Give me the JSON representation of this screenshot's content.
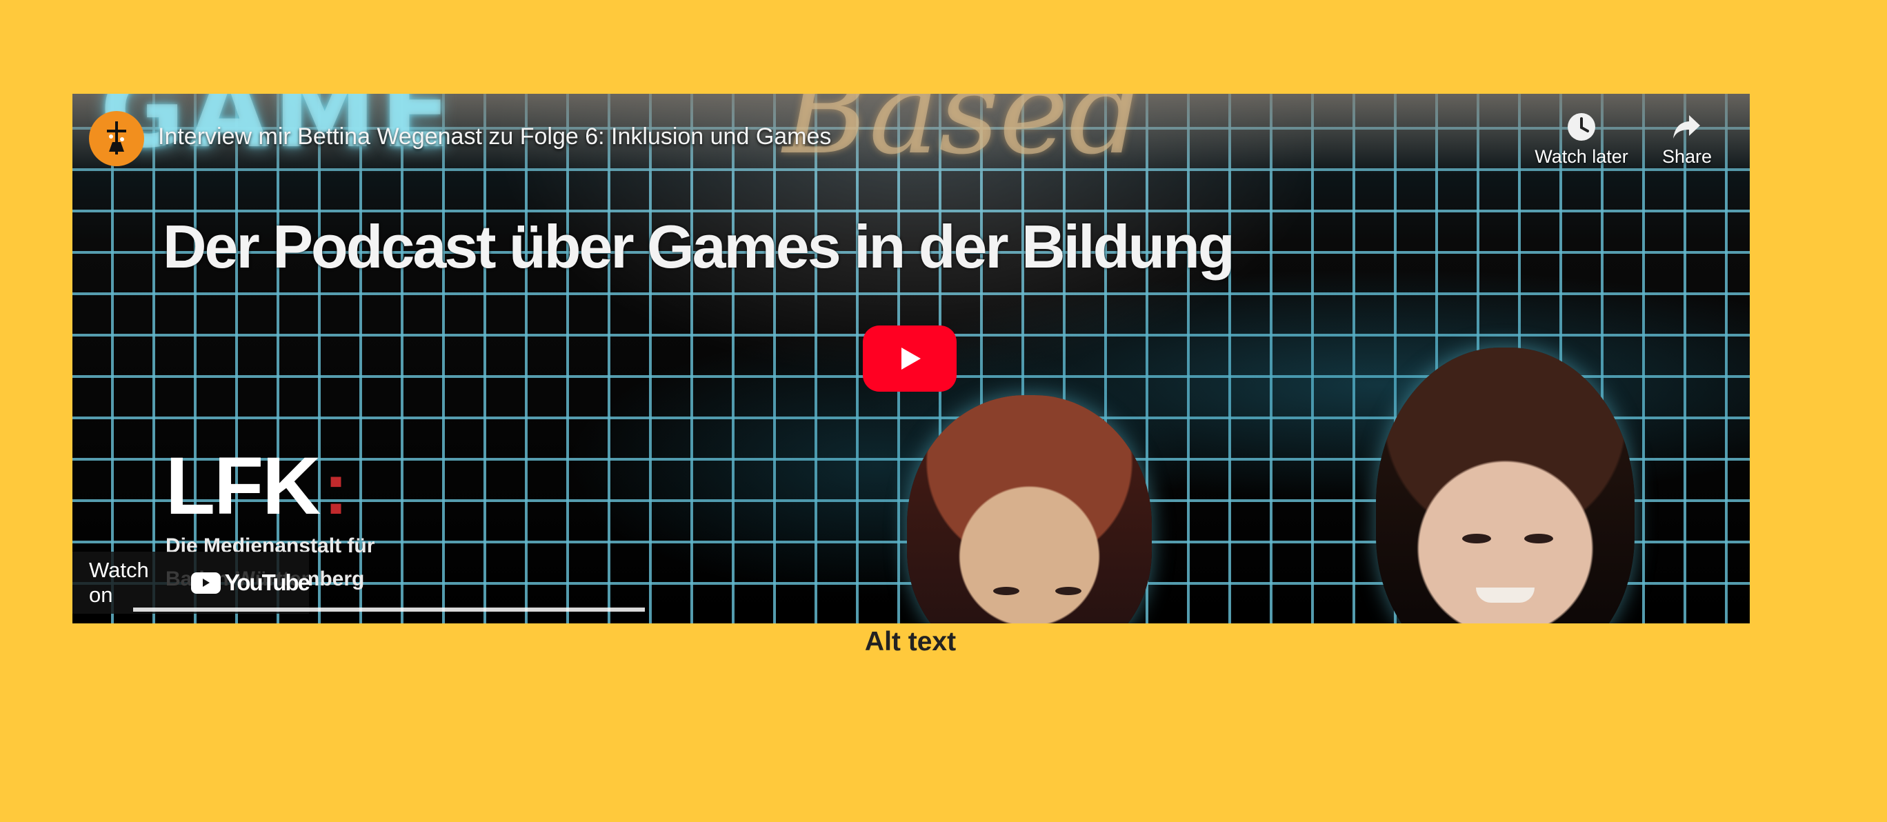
{
  "colors": {
    "page_background": "#ffc93c",
    "player_accent": "#ff0022",
    "channel_avatar": "#f28f1e",
    "grid_lines": "#63b7cc"
  },
  "video": {
    "title": "Interview mir Bettina Wegenast zu Folge 6: Inklusion und Games",
    "channel_avatar_icon": "channel-avatar-icon",
    "play_icon": "play-icon",
    "watch_later_label": "Watch later",
    "watch_later_icon": "clock-icon",
    "share_label": "Share",
    "share_icon": "share-icon",
    "watch_on_label": "Watch on",
    "youtube_logo_text": "YouTube",
    "progress": 0.31
  },
  "thumbnail": {
    "word_game": "GAME",
    "word_based": "Based",
    "headline": "Der Podcast über Games in der Bildung",
    "logo": "LFK",
    "logo_colon": ":",
    "logo_subtitle_line1": "Die Medienanstalt für",
    "logo_subtitle_line2": "Baden-Württemberg"
  },
  "caption": {
    "text": "Alt text"
  }
}
